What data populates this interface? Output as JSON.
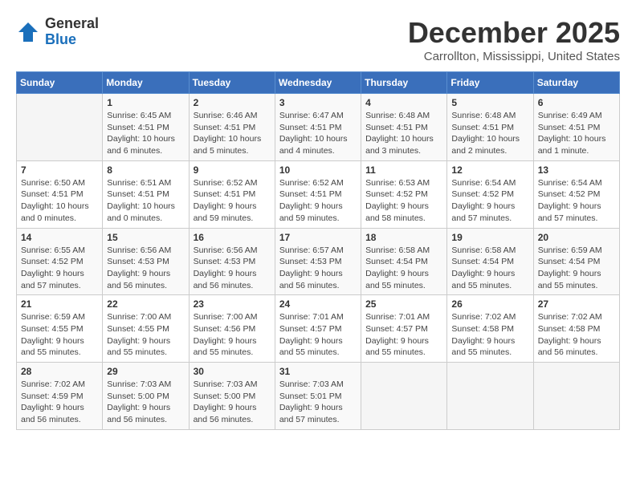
{
  "header": {
    "logo_general": "General",
    "logo_blue": "Blue",
    "title": "December 2025",
    "subtitle": "Carrollton, Mississippi, United States"
  },
  "days_of_week": [
    "Sunday",
    "Monday",
    "Tuesday",
    "Wednesday",
    "Thursday",
    "Friday",
    "Saturday"
  ],
  "weeks": [
    [
      {
        "day": "",
        "sunrise": "",
        "sunset": "",
        "daylight": "",
        "empty": true
      },
      {
        "day": "1",
        "sunrise": "Sunrise: 6:45 AM",
        "sunset": "Sunset: 4:51 PM",
        "daylight": "Daylight: 10 hours and 6 minutes."
      },
      {
        "day": "2",
        "sunrise": "Sunrise: 6:46 AM",
        "sunset": "Sunset: 4:51 PM",
        "daylight": "Daylight: 10 hours and 5 minutes."
      },
      {
        "day": "3",
        "sunrise": "Sunrise: 6:47 AM",
        "sunset": "Sunset: 4:51 PM",
        "daylight": "Daylight: 10 hours and 4 minutes."
      },
      {
        "day": "4",
        "sunrise": "Sunrise: 6:48 AM",
        "sunset": "Sunset: 4:51 PM",
        "daylight": "Daylight: 10 hours and 3 minutes."
      },
      {
        "day": "5",
        "sunrise": "Sunrise: 6:48 AM",
        "sunset": "Sunset: 4:51 PM",
        "daylight": "Daylight: 10 hours and 2 minutes."
      },
      {
        "day": "6",
        "sunrise": "Sunrise: 6:49 AM",
        "sunset": "Sunset: 4:51 PM",
        "daylight": "Daylight: 10 hours and 1 minute."
      }
    ],
    [
      {
        "day": "7",
        "sunrise": "Sunrise: 6:50 AM",
        "sunset": "Sunset: 4:51 PM",
        "daylight": "Daylight: 10 hours and 0 minutes."
      },
      {
        "day": "8",
        "sunrise": "Sunrise: 6:51 AM",
        "sunset": "Sunset: 4:51 PM",
        "daylight": "Daylight: 10 hours and 0 minutes."
      },
      {
        "day": "9",
        "sunrise": "Sunrise: 6:52 AM",
        "sunset": "Sunset: 4:51 PM",
        "daylight": "Daylight: 9 hours and 59 minutes."
      },
      {
        "day": "10",
        "sunrise": "Sunrise: 6:52 AM",
        "sunset": "Sunset: 4:51 PM",
        "daylight": "Daylight: 9 hours and 59 minutes."
      },
      {
        "day": "11",
        "sunrise": "Sunrise: 6:53 AM",
        "sunset": "Sunset: 4:52 PM",
        "daylight": "Daylight: 9 hours and 58 minutes."
      },
      {
        "day": "12",
        "sunrise": "Sunrise: 6:54 AM",
        "sunset": "Sunset: 4:52 PM",
        "daylight": "Daylight: 9 hours and 57 minutes."
      },
      {
        "day": "13",
        "sunrise": "Sunrise: 6:54 AM",
        "sunset": "Sunset: 4:52 PM",
        "daylight": "Daylight: 9 hours and 57 minutes."
      }
    ],
    [
      {
        "day": "14",
        "sunrise": "Sunrise: 6:55 AM",
        "sunset": "Sunset: 4:52 PM",
        "daylight": "Daylight: 9 hours and 57 minutes."
      },
      {
        "day": "15",
        "sunrise": "Sunrise: 6:56 AM",
        "sunset": "Sunset: 4:53 PM",
        "daylight": "Daylight: 9 hours and 56 minutes."
      },
      {
        "day": "16",
        "sunrise": "Sunrise: 6:56 AM",
        "sunset": "Sunset: 4:53 PM",
        "daylight": "Daylight: 9 hours and 56 minutes."
      },
      {
        "day": "17",
        "sunrise": "Sunrise: 6:57 AM",
        "sunset": "Sunset: 4:53 PM",
        "daylight": "Daylight: 9 hours and 56 minutes."
      },
      {
        "day": "18",
        "sunrise": "Sunrise: 6:58 AM",
        "sunset": "Sunset: 4:54 PM",
        "daylight": "Daylight: 9 hours and 55 minutes."
      },
      {
        "day": "19",
        "sunrise": "Sunrise: 6:58 AM",
        "sunset": "Sunset: 4:54 PM",
        "daylight": "Daylight: 9 hours and 55 minutes."
      },
      {
        "day": "20",
        "sunrise": "Sunrise: 6:59 AM",
        "sunset": "Sunset: 4:54 PM",
        "daylight": "Daylight: 9 hours and 55 minutes."
      }
    ],
    [
      {
        "day": "21",
        "sunrise": "Sunrise: 6:59 AM",
        "sunset": "Sunset: 4:55 PM",
        "daylight": "Daylight: 9 hours and 55 minutes."
      },
      {
        "day": "22",
        "sunrise": "Sunrise: 7:00 AM",
        "sunset": "Sunset: 4:55 PM",
        "daylight": "Daylight: 9 hours and 55 minutes."
      },
      {
        "day": "23",
        "sunrise": "Sunrise: 7:00 AM",
        "sunset": "Sunset: 4:56 PM",
        "daylight": "Daylight: 9 hours and 55 minutes."
      },
      {
        "day": "24",
        "sunrise": "Sunrise: 7:01 AM",
        "sunset": "Sunset: 4:57 PM",
        "daylight": "Daylight: 9 hours and 55 minutes."
      },
      {
        "day": "25",
        "sunrise": "Sunrise: 7:01 AM",
        "sunset": "Sunset: 4:57 PM",
        "daylight": "Daylight: 9 hours and 55 minutes."
      },
      {
        "day": "26",
        "sunrise": "Sunrise: 7:02 AM",
        "sunset": "Sunset: 4:58 PM",
        "daylight": "Daylight: 9 hours and 55 minutes."
      },
      {
        "day": "27",
        "sunrise": "Sunrise: 7:02 AM",
        "sunset": "Sunset: 4:58 PM",
        "daylight": "Daylight: 9 hours and 56 minutes."
      }
    ],
    [
      {
        "day": "28",
        "sunrise": "Sunrise: 7:02 AM",
        "sunset": "Sunset: 4:59 PM",
        "daylight": "Daylight: 9 hours and 56 minutes."
      },
      {
        "day": "29",
        "sunrise": "Sunrise: 7:03 AM",
        "sunset": "Sunset: 5:00 PM",
        "daylight": "Daylight: 9 hours and 56 minutes."
      },
      {
        "day": "30",
        "sunrise": "Sunrise: 7:03 AM",
        "sunset": "Sunset: 5:00 PM",
        "daylight": "Daylight: 9 hours and 56 minutes."
      },
      {
        "day": "31",
        "sunrise": "Sunrise: 7:03 AM",
        "sunset": "Sunset: 5:01 PM",
        "daylight": "Daylight: 9 hours and 57 minutes."
      },
      {
        "day": "",
        "sunrise": "",
        "sunset": "",
        "daylight": "",
        "empty": true
      },
      {
        "day": "",
        "sunrise": "",
        "sunset": "",
        "daylight": "",
        "empty": true
      },
      {
        "day": "",
        "sunrise": "",
        "sunset": "",
        "daylight": "",
        "empty": true
      }
    ]
  ]
}
